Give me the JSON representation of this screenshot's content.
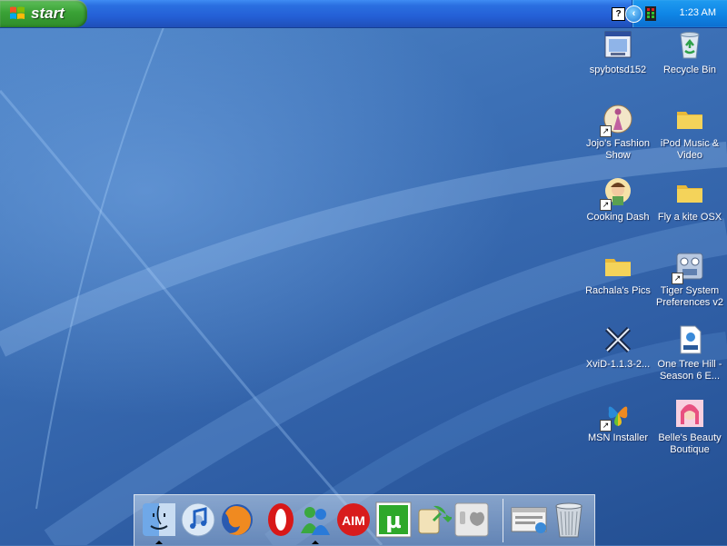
{
  "taskbar": {
    "start_label": "start",
    "clock": "1:23 AM",
    "help_glyph": "?",
    "tray_expand_glyph": "‹"
  },
  "desktop_icons": [
    {
      "label": "spybotsd152",
      "icon": "installer-window-icon"
    },
    {
      "label": "Recycle Bin",
      "icon": "recycle-bin-icon"
    },
    {
      "label": "Jojo's Fashion Show",
      "icon": "fashion-game-icon",
      "shortcut": true
    },
    {
      "label": "iPod Music & Video",
      "icon": "folder-icon"
    },
    {
      "label": "Cooking Dash",
      "icon": "cooking-game-icon",
      "shortcut": true
    },
    {
      "label": "Fly a kite OSX",
      "icon": "folder-icon"
    },
    {
      "label": "Rachala's Pics",
      "icon": "folder-icon"
    },
    {
      "label": "Tiger System Preferences v2",
      "icon": "system-preferences-icon",
      "shortcut": true
    },
    {
      "label": "XviD-1.1.3-2...",
      "icon": "xvid-icon"
    },
    {
      "label": "One Tree Hill - Season 6 E...",
      "icon": "mpeg4-file-icon"
    },
    {
      "label": "MSN Installer",
      "icon": "msn-butterfly-icon",
      "shortcut": true
    },
    {
      "label": "Belle's Beauty Boutique",
      "icon": "beauty-game-icon"
    }
  ],
  "dock": {
    "items": [
      {
        "name": "finder",
        "icon": "finder-icon",
        "running": true
      },
      {
        "name": "itunes",
        "icon": "itunes-icon"
      },
      {
        "name": "firefox",
        "icon": "firefox-icon"
      },
      {
        "name": "opera",
        "icon": "opera-icon"
      },
      {
        "name": "messenger",
        "icon": "messenger-buddies-icon",
        "running": true
      },
      {
        "name": "aim",
        "icon": "aim-icon",
        "text": "AIM"
      },
      {
        "name": "utorrent",
        "icon": "utorrent-icon",
        "text": "µ"
      },
      {
        "name": "sync",
        "icon": "sync-icon"
      },
      {
        "name": "apple-system",
        "icon": "apple-switch-icon"
      },
      {
        "name": "network-window",
        "icon": "network-window-icon"
      },
      {
        "name": "trash",
        "icon": "trash-can-icon"
      }
    ]
  },
  "colors": {
    "taskbar_blue": "#245fd6",
    "start_green": "#3aa236",
    "tray_blue": "#0f86e6",
    "folder_yellow": "#f4d35a"
  }
}
